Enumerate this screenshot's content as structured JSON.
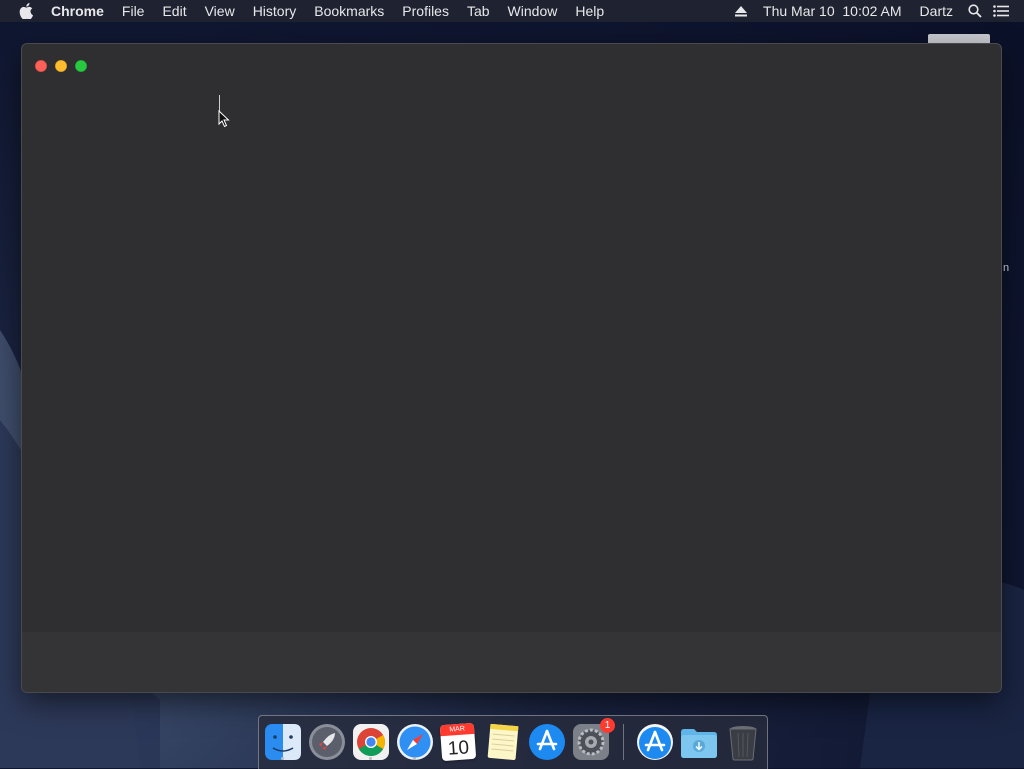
{
  "menubar": {
    "app_name": "Chrome",
    "menus": [
      "File",
      "Edit",
      "View",
      "History",
      "Bookmarks",
      "Profiles",
      "Tab",
      "Window",
      "Help"
    ],
    "clock": "Thu Mar 10  10:02 AM",
    "user": "Dartz"
  },
  "desktop": {
    "partial_label": "n"
  },
  "dock": {
    "apps": [
      {
        "name": "Finder",
        "running": true
      },
      {
        "name": "Launchpad",
        "running": false
      },
      {
        "name": "Chrome",
        "running": true
      },
      {
        "name": "Safari",
        "running": true
      },
      {
        "name": "Calendar",
        "running": false,
        "month": "MAR",
        "day": "10"
      },
      {
        "name": "Notes",
        "running": false
      },
      {
        "name": "App Store",
        "running": false
      },
      {
        "name": "System Preferences",
        "running": false,
        "badge": "1"
      },
      {
        "name": "App Store Downloads",
        "running": false
      },
      {
        "name": "Downloads Folder",
        "running": false
      },
      {
        "name": "Trash",
        "running": false
      }
    ]
  },
  "colors": {
    "close": "#fe5f57",
    "minimize": "#febc2e",
    "zoom": "#28c840",
    "window_bg": "#2f2f31"
  }
}
